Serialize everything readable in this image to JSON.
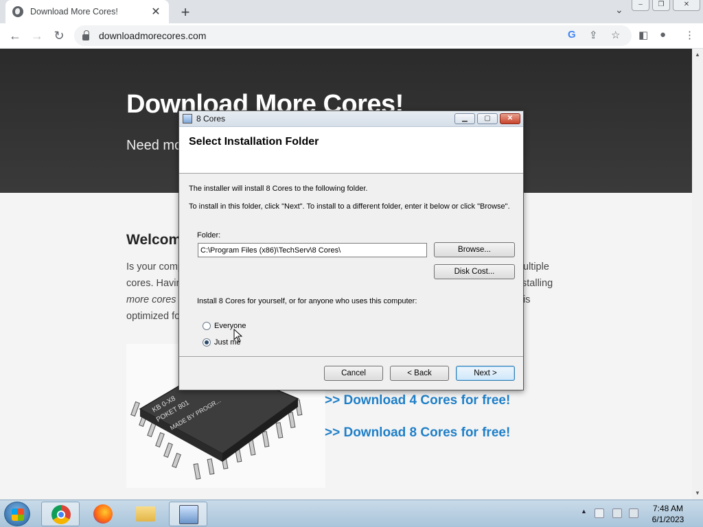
{
  "browser": {
    "tab_title": "Download More Cores!",
    "tab_close": "✕",
    "new_tab": "+",
    "url": "downloadmorecores.com"
  },
  "page": {
    "hero_title": "Download More Cores!",
    "hero_subtitle_partial": "Need mo",
    "welcome_partial": "Welcom",
    "para_left": [
      "Is your comp",
      "cores. Havin",
      "more cores",
      "optimized fo"
    ],
    "para_right": [
      "ultiple",
      "stalling",
      "is"
    ],
    "download_links": [
      ">> Download 4 Cores for free!",
      ">> Download 8 Cores for free!"
    ],
    "chip_text": [
      "KB 0-X8",
      "POKET 801",
      "MADE BY PROGR..."
    ]
  },
  "dialog": {
    "title": "8 Cores",
    "heading": "Select Installation Folder",
    "line1": "The installer will install 8 Cores to the following folder.",
    "line2": "To install in this folder, click \"Next\". To install to a different folder, enter it below or click \"Browse\".",
    "folder_label": "Folder:",
    "folder_value": "C:\\Program Files (x86)\\TechServ\\8 Cores\\",
    "browse_label": "Browse...",
    "disk_cost_label": "Disk Cost...",
    "install_for_label": "Install 8 Cores for yourself, or for anyone who uses this computer:",
    "radio_everyone": "Everyone",
    "radio_just_me": "Just me",
    "selected_radio": "Just me",
    "cancel_label": "Cancel",
    "back_label": "< Back",
    "next_label": "Next >"
  },
  "taskbar": {
    "time": "7:48 AM",
    "date": "6/1/2023",
    "apps": [
      "chrome",
      "firefox",
      "file-explorer",
      "installer"
    ]
  },
  "colors": {
    "link_blue": "#1e7fc8",
    "hero_bg": "#2b2b2b"
  }
}
